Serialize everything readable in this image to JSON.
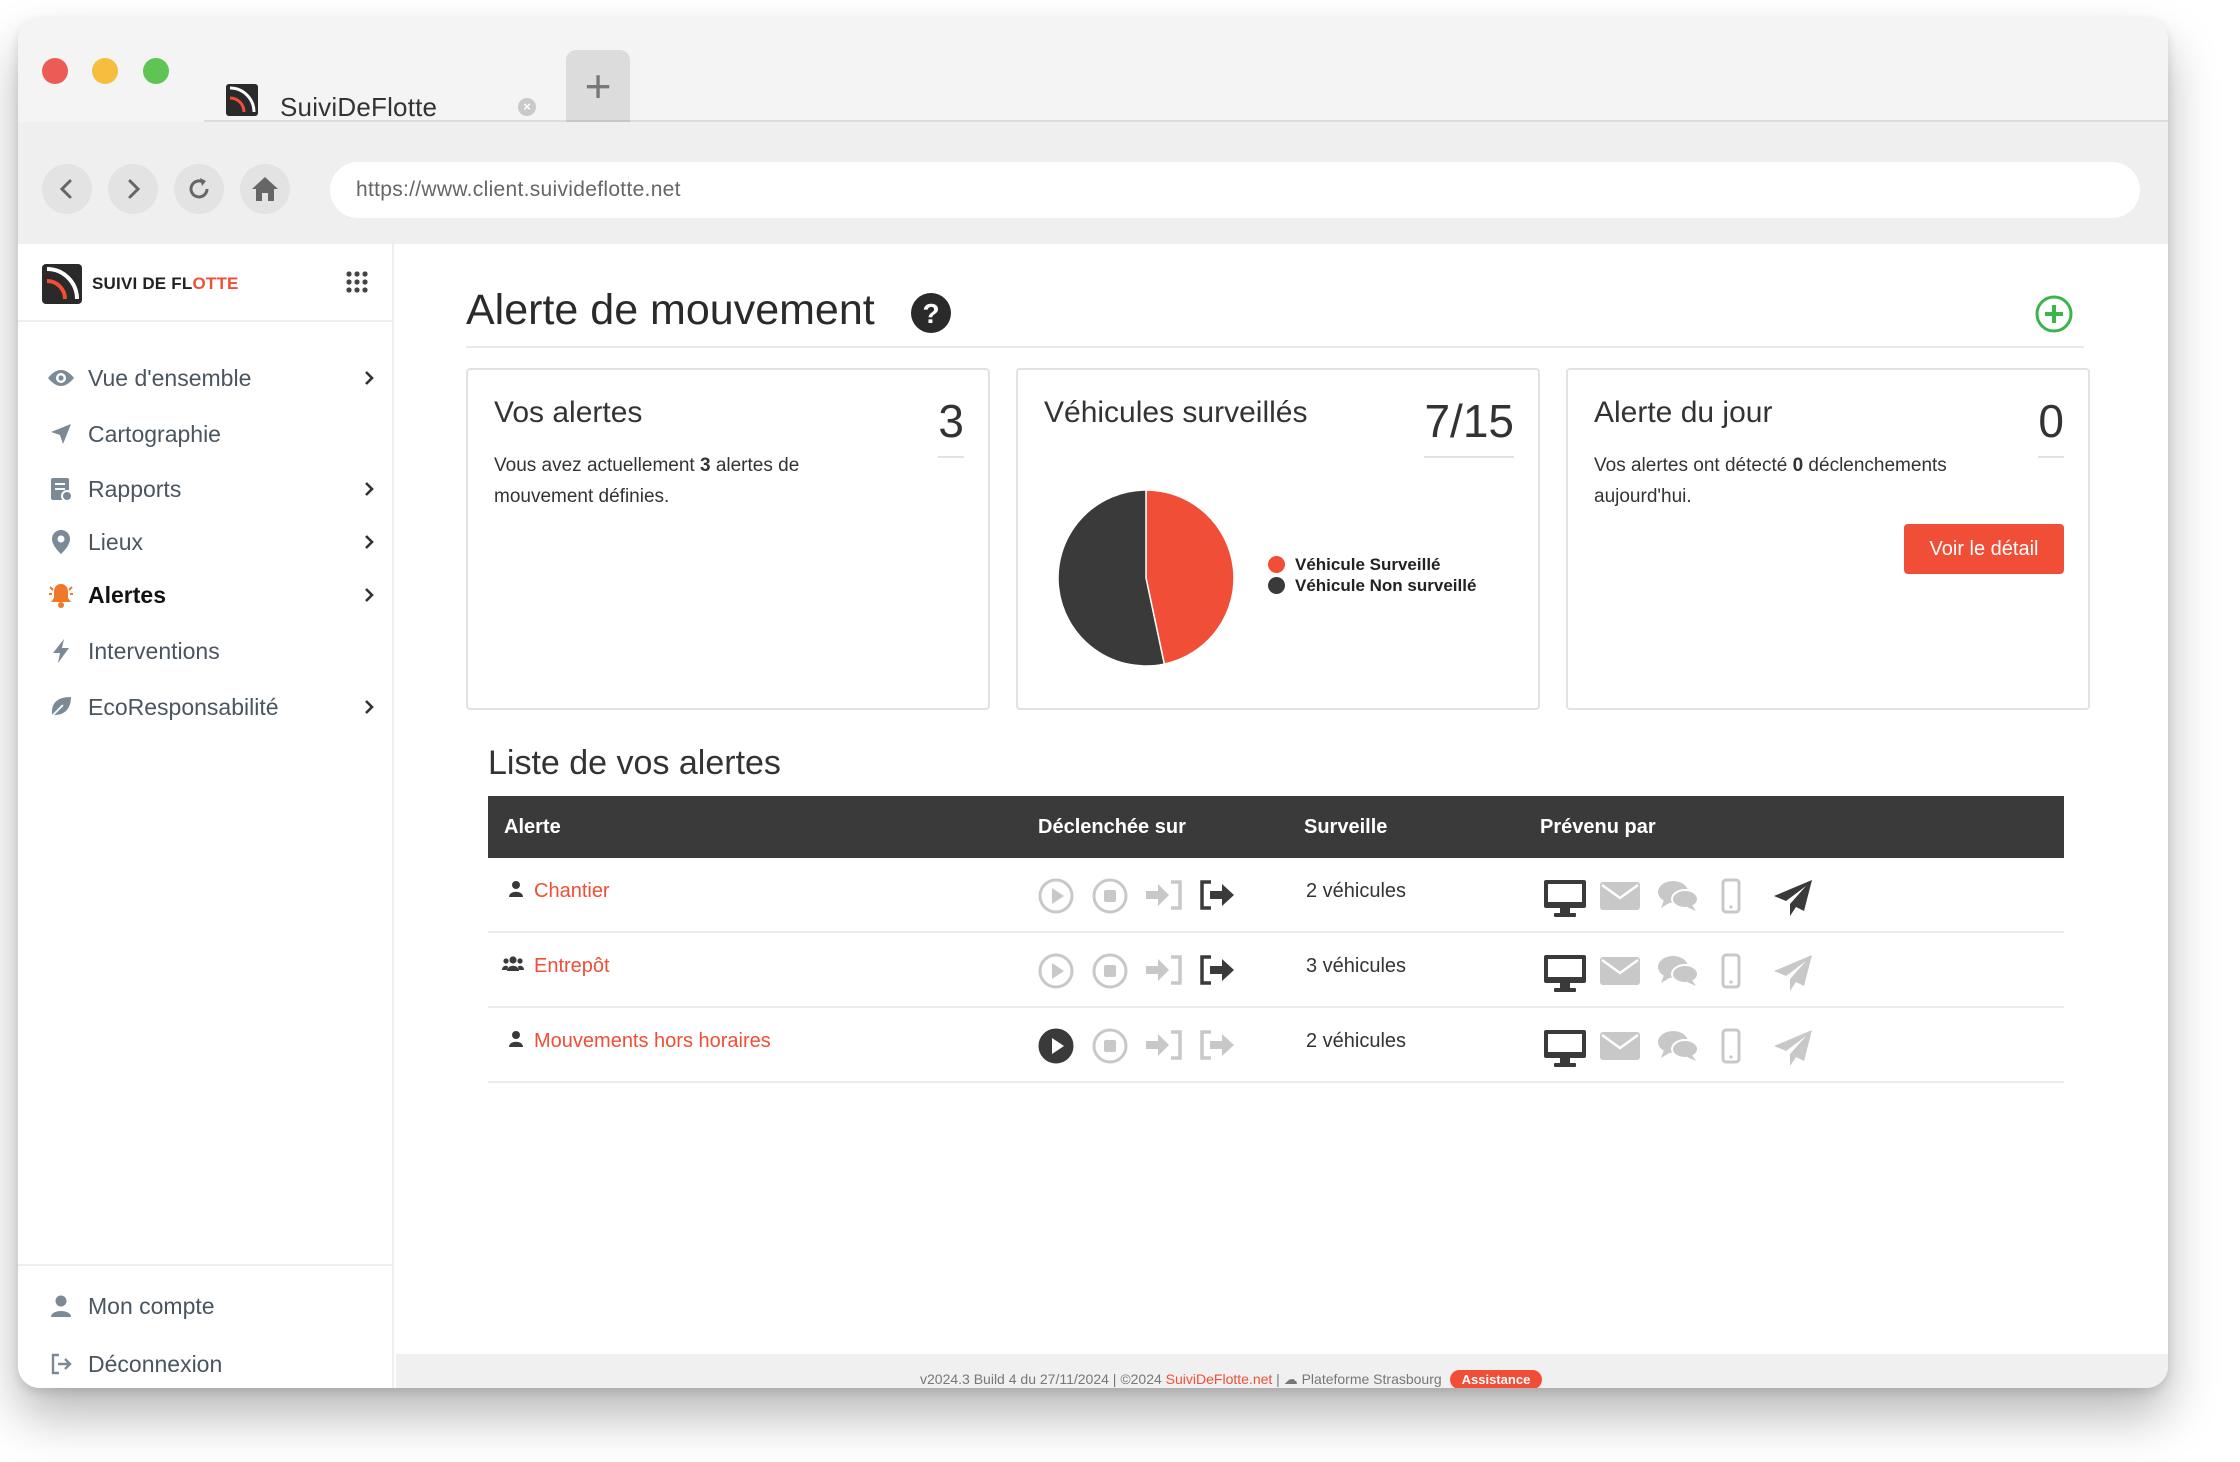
{
  "browser": {
    "tab_title": "SuiviDeFlotte",
    "url": "https://www.client.suivideflotte.net"
  },
  "brand": {
    "name_part1": "SUIVI DE FL",
    "name_accent": "OTTE"
  },
  "sidebar": {
    "items": [
      {
        "label": "Vue d'ensemble",
        "icon": "eye-icon"
      },
      {
        "label": "Cartographie",
        "icon": "location-arrow-icon"
      },
      {
        "label": "Rapports",
        "icon": "report-icon"
      },
      {
        "label": "Lieux",
        "icon": "map-pin-icon"
      },
      {
        "label": "Alertes",
        "icon": "bell-icon"
      },
      {
        "label": "Interventions",
        "icon": "bolt-icon"
      },
      {
        "label": "EcoResponsabilité",
        "icon": "leaf-icon"
      }
    ],
    "bottom": [
      {
        "label": "Mon compte",
        "icon": "user-icon"
      },
      {
        "label": "Déconnexion",
        "icon": "logout-icon"
      }
    ]
  },
  "page": {
    "title": "Alerte de mouvement"
  },
  "cards": {
    "alerts": {
      "title": "Vos alertes",
      "value": "3",
      "text_before": "Vous avez actuellement ",
      "text_bold": "3",
      "text_after": " alertes de mouvement définies."
    },
    "vehicles": {
      "title": "Véhicules surveillés",
      "value": "7/15",
      "legend_monitored": "Véhicule Surveillé",
      "legend_unmonitored": "Véhicule Non surveillé"
    },
    "today": {
      "title": "Alerte du jour",
      "value": "0",
      "text_before": "Vos alertes ont détecté ",
      "text_bold": "0",
      "text_after": " déclenchements aujourd'hui.",
      "button": "Voir le détail"
    }
  },
  "chart_data": {
    "type": "pie",
    "labels": [
      "Véhicule Surveillé",
      "Véhicule Non surveillé"
    ],
    "values": [
      7,
      8
    ],
    "colors": [
      "#f04e36",
      "#3a3a3a"
    ]
  },
  "list": {
    "title": "Liste de vos alertes",
    "headers": [
      "Alerte",
      "Déclenchée sur",
      "Surveille",
      "Prévenu par"
    ],
    "rows": [
      {
        "name": "Chantier",
        "user_icon": "user-icon",
        "triggers": [
          false,
          false,
          false,
          true
        ],
        "watch": "2 véhicules",
        "notify": [
          true,
          false,
          false,
          false,
          true
        ]
      },
      {
        "name": "Entrepôt",
        "user_icon": "users-icon",
        "triggers": [
          false,
          false,
          false,
          true
        ],
        "watch": "3 véhicules",
        "notify": [
          true,
          false,
          false,
          false,
          false
        ]
      },
      {
        "name": "Mouvements hors horaires",
        "user_icon": "user-icon",
        "triggers": [
          true,
          false,
          false,
          false
        ],
        "watch": "2 véhicules",
        "notify": [
          true,
          false,
          false,
          false,
          false
        ]
      }
    ]
  },
  "footer": {
    "version": "v2024.3 Build 4 du 27/11/2024 | ©2024 ",
    "link": "SuiviDeFlotte.net",
    "platform": " | ☁ Plateforme Strasbourg",
    "badge": "Assistance"
  },
  "colors": {
    "accent": "#f04e36",
    "dark": "#3a3a3a",
    "muted": "#c8c8c8",
    "add_green": "#3bb54a"
  }
}
